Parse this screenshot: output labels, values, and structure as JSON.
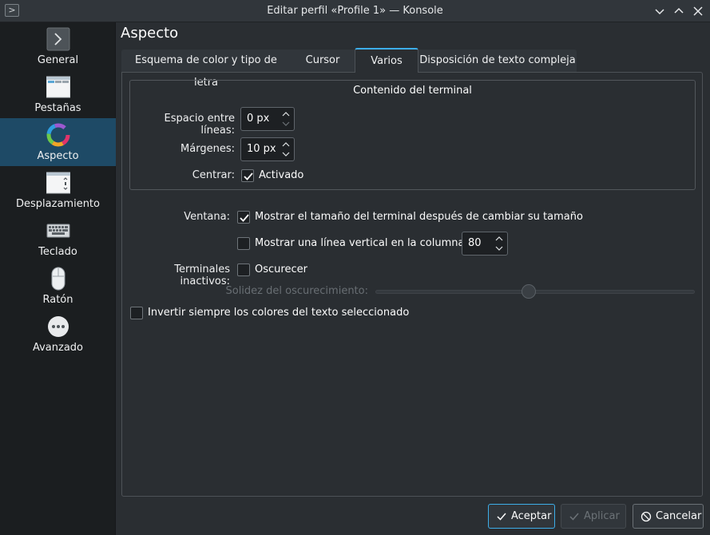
{
  "window": {
    "title": "Editar perfil «Profile 1» — Konsole"
  },
  "sidebar": {
    "items": [
      {
        "label": "General",
        "icon": "terminal-icon"
      },
      {
        "label": "Pestañas",
        "icon": "tabs-window-icon"
      },
      {
        "label": "Aspecto",
        "icon": "color-wheel-icon",
        "active": true
      },
      {
        "label": "Desplazamiento",
        "icon": "scroll-window-icon"
      },
      {
        "label": "Teclado",
        "icon": "keyboard-icon"
      },
      {
        "label": "Ratón",
        "icon": "mouse-icon"
      },
      {
        "label": "Avanzado",
        "icon": "more-options-icon"
      }
    ]
  },
  "main": {
    "heading": "Aspecto",
    "tabs": [
      {
        "label": "Esquema de color y tipo de letra"
      },
      {
        "label": "Cursor"
      },
      {
        "label": "Varios",
        "active": true
      },
      {
        "label": "Disposición de texto compleja"
      }
    ],
    "group": {
      "title": "Contenido del terminal",
      "line_spacing_label": "Espacio entre líneas:",
      "line_spacing_value": "0 px",
      "margins_label": "Márgenes:",
      "margins_value": "10 px",
      "center_label": "Centrar:",
      "center_checkbox_label": "Activado",
      "center_checked": true
    },
    "window_label": "Ventana:",
    "show_size_label": "Mostrar el tamaño del terminal después de cambiar su tamaño",
    "show_size_checked": true,
    "vertical_line_label": "Mostrar una línea vertical en la columna:",
    "vertical_line_checked": false,
    "vertical_line_column": "80",
    "inactive_label": "Terminales inactivos:",
    "dim_label": "Oscurecer",
    "dim_checked": false,
    "dim_strength_label": "Solidez del oscurecimiento:",
    "dim_strength_fraction": 0.48,
    "invert_label": "Invertir siempre los colores del texto seleccionado",
    "invert_checked": false
  },
  "buttons": {
    "ok": "Aceptar",
    "apply": "Aplicar",
    "cancel": "Cancelar"
  },
  "colors": {
    "accent": "#3daee9",
    "active_sidebar": "#1e4a66",
    "background": "#2a2e32"
  }
}
